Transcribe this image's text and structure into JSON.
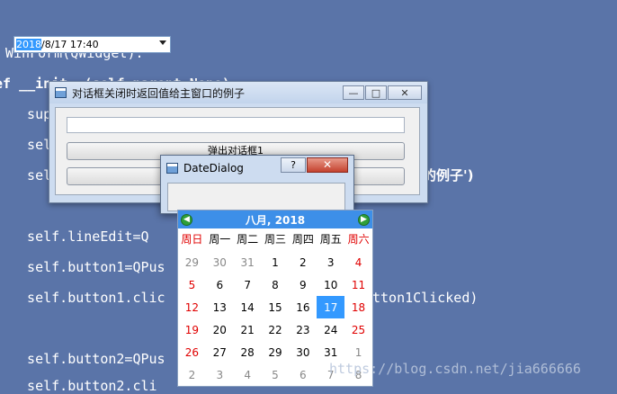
{
  "code": {
    "lines": [
      "WinForm(QWidget):",
      "ef __init__(self,parent=None):",
      "  sup",
      "  sel",
      "  sel",
      "  self.lineEdit=Q",
      "  self.button1=QPus",
      "  self.button1.clic",
      "  self.button2=QPus",
      "  self.button2.cli"
    ],
    "right_fragments": {
      "connect_tail": "tton1Clicked)",
      "title_tail": "的例子')"
    }
  },
  "main_window": {
    "title": "对话框关闭时返回值给主窗口的例子",
    "line_edit_value": "",
    "button1_label": "弹出对话框1",
    "button2_label": "",
    "minimize": "—",
    "maximize": "□",
    "close": "✕"
  },
  "date_dialog": {
    "title": "DateDialog",
    "help": "?",
    "close": "✕",
    "date_year_selected": "2018",
    "date_rest": "/8/17 17:40"
  },
  "calendar": {
    "month_title": "八月,  2018",
    "prev_icon": "arrow-left",
    "next_icon": "arrow-right",
    "weekdays": [
      "周日",
      "周一",
      "周二",
      "周三",
      "周四",
      "周五",
      "周六"
    ],
    "weeks": [
      [
        "29",
        "30",
        "31",
        "1",
        "2",
        "3",
        "4"
      ],
      [
        "5",
        "6",
        "7",
        "8",
        "9",
        "10",
        "11"
      ],
      [
        "12",
        "13",
        "14",
        "15",
        "16",
        "17",
        "18"
      ],
      [
        "19",
        "20",
        "21",
        "22",
        "23",
        "24",
        "25"
      ],
      [
        "26",
        "27",
        "28",
        "29",
        "30",
        "31",
        "1"
      ],
      [
        "2",
        "3",
        "4",
        "5",
        "6",
        "7",
        "8"
      ]
    ],
    "selected_day": "17",
    "colors": {
      "weekend": "#e00000",
      "selected": "#3399ff",
      "header": "#3d8fe8"
    }
  },
  "watermark": "https://blog.csdn.net/jia666666"
}
